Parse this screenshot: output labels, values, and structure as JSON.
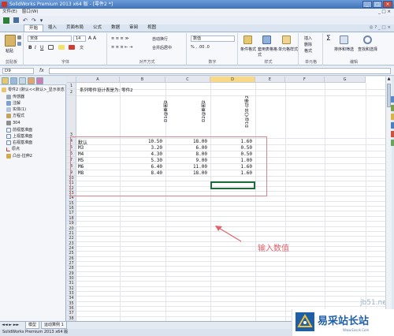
{
  "window": {
    "title": "SolidWorks Premium 2013 x64 版 - [零件2 *]",
    "buttons": [
      "_",
      "□",
      "×"
    ]
  },
  "menubar": {
    "items": [
      "文件(E)",
      "窗口(W)"
    ],
    "right": "_ □ ×"
  },
  "ribbon": {
    "tabs": [
      "开始",
      "插入",
      "页面布局",
      "公式",
      "数据",
      "审阅",
      "视图"
    ],
    "active_tab": "开始",
    "clipboard": {
      "paste": "粘贴",
      "label": "剪贴板"
    },
    "font": {
      "name": "宋体",
      "size": "14",
      "bold": "B",
      "italic": "I",
      "underline": "U",
      "label": "字体"
    },
    "alignment": {
      "wrap": "自动换行",
      "merge": "合并后居中",
      "label": "对齐方式"
    },
    "number": {
      "format": "数值",
      "label": "数字"
    },
    "styles": {
      "conditional": "条件格式",
      "table": "套用表格格式",
      "cell": "单元格样式",
      "label": "样式"
    },
    "cells": {
      "insert": "插入",
      "delete": "删除",
      "format": "格式",
      "label": "单元格"
    },
    "editing": {
      "sort": "排序和筛选",
      "find": "查找和选择",
      "label": "编辑"
    }
  },
  "formula_bar": {
    "name_box": "D9",
    "fx": "fx",
    "value": ""
  },
  "feature_tree": {
    "items": [
      "零件2 (默认<<默认>_显示状态",
      "传感器",
      "注解",
      "实体(1)",
      "方程式",
      "304",
      "前视基准面",
      "上视基准面",
      "右视基准面",
      "原点",
      "凸台-拉伸2"
    ]
  },
  "sheet": {
    "columns": [
      "A",
      "B",
      "C",
      "D",
      "E",
      "F",
      "G"
    ],
    "selected_column": "D",
    "rows": [
      "1",
      "2",
      "3",
      "4",
      "5",
      "6",
      "7",
      "8",
      "9",
      "10",
      "11",
      "12",
      "13",
      "14",
      "15",
      "16",
      "17",
      "18",
      "19",
      "20",
      "21",
      "22",
      "23",
      "24",
      "25",
      "26",
      "27",
      "28",
      "29",
      "30",
      "31",
      "32",
      "33",
      "34",
      "35",
      "36",
      "37",
      "38",
      "39",
      "40"
    ],
    "title": "系列零件设计表是为:  零件2",
    "headers": [
      "D1@草图2",
      "D2@草图2",
      "D1@凸台-拉伸2"
    ],
    "table": [
      [
        "默认",
        "10.50",
        "18.00",
        "1.60"
      ],
      [
        "M3",
        "3.20",
        "6.00",
        "0.50"
      ],
      [
        "M4",
        "4.30",
        "8.00",
        "0.50"
      ],
      [
        "M5",
        "5.30",
        "9.00",
        "1.00"
      ],
      [
        "M6",
        "6.40",
        "11.00",
        "1.60"
      ],
      [
        "M8",
        "8.40",
        "18.00",
        "1.60"
      ]
    ]
  },
  "bottom_tabs": [
    "模型",
    "运动算例 1"
  ],
  "status": "SolidWorks Premium 2013 x64 版",
  "annotation": {
    "text": "输入数值",
    "color": "#e0646c"
  },
  "watermark": {
    "url": "jb51.net",
    "brand": "易采站长站",
    "sub": "Www.Easck.Com"
  }
}
